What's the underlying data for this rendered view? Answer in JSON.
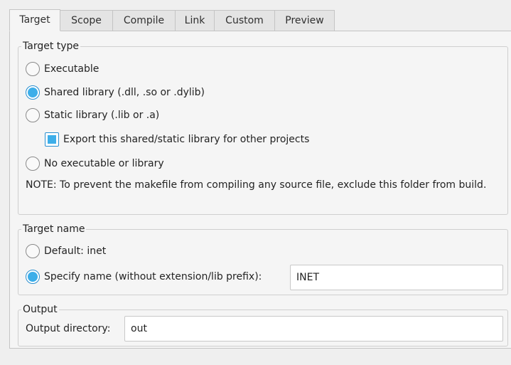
{
  "tabs": [
    {
      "label": "Target",
      "active": true
    },
    {
      "label": "Scope",
      "active": false
    },
    {
      "label": "Compile",
      "active": false
    },
    {
      "label": "Link",
      "active": false
    },
    {
      "label": "Custom",
      "active": false
    },
    {
      "label": "Preview",
      "active": false
    }
  ],
  "target_type": {
    "title": "Target type",
    "options": [
      {
        "label": "Executable",
        "checked": false
      },
      {
        "label": "Shared library (.dll, .so or .dylib)",
        "checked": true
      },
      {
        "label": "Static library (.lib or .a)",
        "checked": false
      },
      {
        "label": "No executable or library",
        "checked": false
      }
    ],
    "export_checkbox": {
      "label": "Export this shared/static library for other projects",
      "checked": true
    },
    "note": "NOTE: To prevent the makefile from compiling any source file, exclude this folder from build."
  },
  "target_name": {
    "title": "Target name",
    "default_option": {
      "label": "Default: inet",
      "checked": false
    },
    "specify_option": {
      "label": "Specify name (without extension/lib prefix):",
      "checked": true
    },
    "name_value": "INET"
  },
  "output": {
    "title": "Output",
    "directory_label": "Output directory:",
    "directory_value": "out"
  },
  "colors": {
    "accent": "#3daee9",
    "panel": "#f5f5f5",
    "border": "#c4c4c4"
  }
}
